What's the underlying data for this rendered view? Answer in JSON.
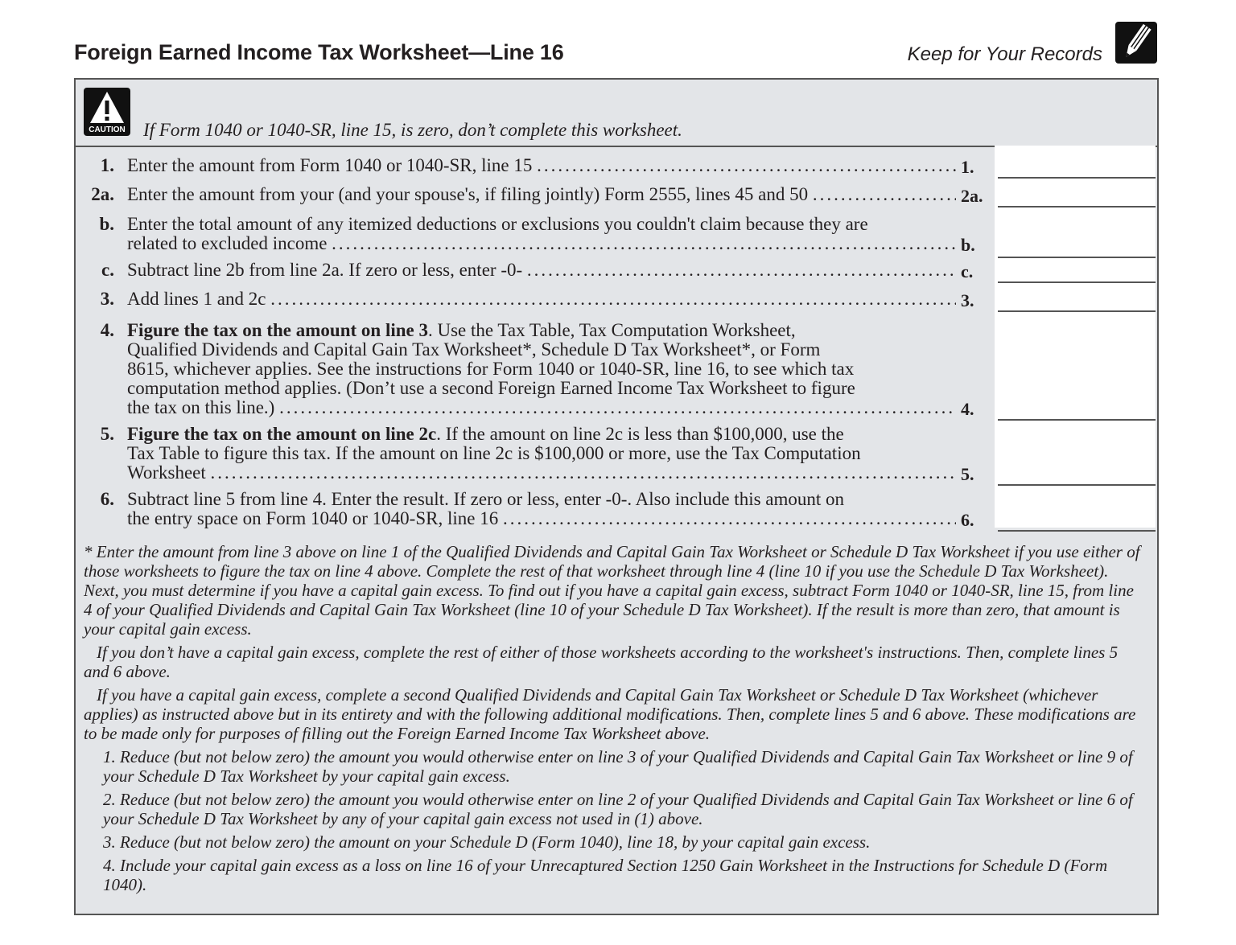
{
  "header": {
    "title": "Foreign Earned Income Tax Worksheet—Line 16",
    "keep_records": "Keep for Your Records",
    "records_icon": "pencil-icon"
  },
  "caution": {
    "icon": "caution-icon",
    "icon_label": "CAUTION",
    "text": "If Form 1040 or 1040-SR, line 15, is zero, don’t complete this worksheet."
  },
  "lines": [
    {
      "num": "1.",
      "label": "1.",
      "text": "Enter the amount from Form 1040 or 1040-SR, line 15",
      "value": ""
    },
    {
      "num": "2a.",
      "label": "2a.",
      "text": "Enter the amount from your (and your spouse's, if filing jointly) Form 2555, lines 45 and 50",
      "value": ""
    },
    {
      "num": "b.",
      "label": "b.",
      "text": "Enter the total amount of any itemized deductions or exclusions you couldn't claim because they are",
      "text2": "related to excluded income",
      "value": ""
    },
    {
      "num": "c.",
      "label": "c.",
      "text": "Subtract line 2b from line 2a. If zero or less, enter -0-",
      "value": ""
    },
    {
      "num": "3.",
      "label": "3.",
      "text": "Add lines 1 and 2c",
      "value": ""
    },
    {
      "num": "4.",
      "label": "4.",
      "bold": "Figure the tax on the amount on line 3",
      "text": ". Use the Tax Table, Tax Computation Worksheet,",
      "text_lines": [
        "Qualified Dividends and Capital Gain Tax Worksheet*, Schedule D Tax Worksheet*, or Form",
        "8615, whichever applies. See the instructions for Form 1040 or 1040-SR, line 16, to see which tax",
        "computation method applies. (Don’t use a second Foreign Earned Income Tax Worksheet to figure",
        "the tax on this line.)"
      ],
      "value": ""
    },
    {
      "num": "5.",
      "label": "5.",
      "bold": "Figure the tax on the amount on line 2c",
      "text": ". If the amount on line 2c is less than $100,000, use the",
      "text_lines": [
        "Tax Table to figure this tax. If the amount on line 2c is $100,000 or more, use the Tax Computation",
        "Worksheet"
      ],
      "value": ""
    },
    {
      "num": "6.",
      "label": "6.",
      "text": "Subtract line 5 from line 4. Enter the result. If zero or less, enter -0-. Also include this amount on",
      "text2": "the entry space on Form 1040 or 1040-SR, line 16",
      "value": ""
    }
  ],
  "notes": {
    "footnote": "* Enter the amount from line 3 above on line 1 of the Qualified Dividends and Capital Gain Tax Worksheet or Schedule D Tax Worksheet if you use either of those worksheets to figure the tax on line 4 above. Complete the rest of that worksheet through line 4 (line 10 if you use the Schedule D Tax Worksheet). Next, you must determine if you have a capital gain excess. To find out if you have a capital gain excess, subtract Form 1040 or 1040-SR, line 15, from line 4 of your Qualified Dividends and Capital Gain Tax Worksheet (line 10 of your Schedule D Tax Worksheet). If the result is more than zero, that amount is your capital gain excess.",
    "no_excess": "If you don’t have a capital gain excess, complete the rest of either of those worksheets according to the worksheet's instructions. Then, complete lines 5 and 6 above.",
    "has_excess": "If you have a capital gain excess, complete a second Qualified Dividends and Capital Gain Tax Worksheet or Schedule D Tax Worksheet (whichever applies) as instructed above but in its entirety and with the following additional modifications. Then, complete lines 5 and 6 above. These modifications are to be made only for purposes of filling out the Foreign Earned Income Tax Worksheet above.",
    "modifications": [
      "1. Reduce (but not below zero) the amount you would otherwise enter on line 3 of your Qualified Dividends and Capital Gain Tax Worksheet or line 9 of your Schedule D Tax Worksheet by your capital gain excess.",
      "2. Reduce (but not below zero) the amount you would otherwise enter on line 2 of your Qualified Dividends and Capital Gain Tax Worksheet or line 6 of your Schedule D Tax Worksheet by any of your capital gain excess not used in (1) above.",
      "3. Reduce (but not below zero) the amount on your Schedule D (Form 1040), line 18, by your capital gain excess.",
      "4. Include your capital gain excess as a loss on line 16 of your Unrecaptured Section 1250 Gain Worksheet in the Instructions for Schedule D (Form 1040)."
    ]
  },
  "colors": {
    "panel_bg": "#e3e5e8",
    "entry_bg": "#ffffff",
    "border": "#555555",
    "text": "#231f20"
  }
}
